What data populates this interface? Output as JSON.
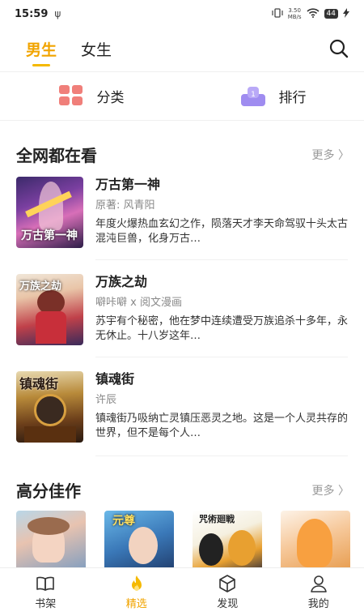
{
  "status_bar": {
    "time": "15:59",
    "net_speed_value": "3.50",
    "net_speed_unit": "MB/s",
    "battery": "44"
  },
  "header": {
    "tabs": [
      {
        "label": "男生",
        "active": true
      },
      {
        "label": "女生",
        "active": false
      }
    ]
  },
  "categories": [
    {
      "label": "分类",
      "icon": "category-grid-icon",
      "color": "#f07f7a"
    },
    {
      "label": "排行",
      "icon": "ranking-podium-icon",
      "color": "#9f8cf0",
      "badge": "1"
    }
  ],
  "section_trending": {
    "title": "全网都在看",
    "more": "更多",
    "books": [
      {
        "title": "万古第一神",
        "author": "原著: 风青阳",
        "desc": "年度火爆热血玄幻之作，陨落天才李天命驾驭十头太古混沌巨兽，化身万古…",
        "cover_text": "万古第一神"
      },
      {
        "title": "万族之劫",
        "author": "噼咔噼 x 阅文漫画",
        "desc": "苏宇有个秘密，他在梦中连续遭受万族追杀十多年，永无休止。十八岁这年…",
        "cover_text": "万族之劫"
      },
      {
        "title": "镇魂街",
        "author": "许辰",
        "desc": "镇魂街乃吸纳亡灵镇压恶灵之地。这是一个人灵共存的世界，但不是每个人…",
        "cover_text": "镇魂街"
      }
    ]
  },
  "section_high_score": {
    "title": "高分佳作",
    "more": "更多",
    "cover_texts": [
      "",
      "元尊",
      "咒術廻戦",
      ""
    ]
  },
  "bottom_nav": [
    {
      "label": "书架",
      "icon": "bookshelf-icon",
      "active": false
    },
    {
      "label": "精选",
      "icon": "flame-icon",
      "active": true
    },
    {
      "label": "发现",
      "icon": "discover-cube-icon",
      "active": false
    },
    {
      "label": "我的",
      "icon": "profile-icon",
      "active": false
    }
  ],
  "colors": {
    "accent": "#f1a400",
    "underline": "#f5b900",
    "muted": "#888888"
  }
}
